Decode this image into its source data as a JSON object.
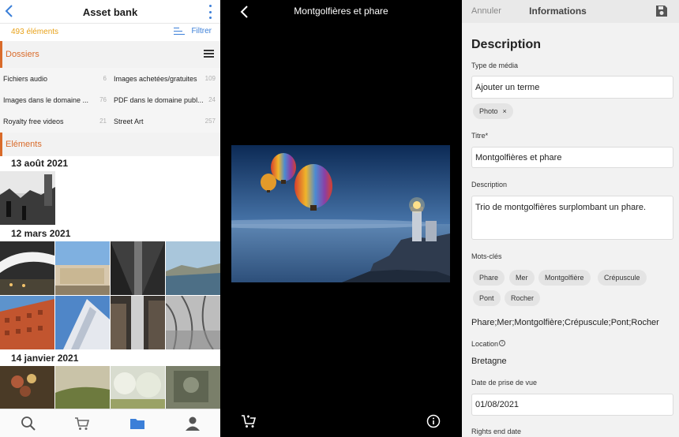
{
  "asset_bank": {
    "title": "Asset bank",
    "count": "493 éléments",
    "filter_label": "Filtrer",
    "folders_section": "Dossiers",
    "folders": [
      {
        "name": "Fichiers audio",
        "count": "6"
      },
      {
        "name": "Images achetées/gratuites",
        "count": "109"
      },
      {
        "name": "Images dans le domaine ...",
        "count": "76"
      },
      {
        "name": "PDF dans le domaine publ...",
        "count": "24"
      },
      {
        "name": "Royalty free videos",
        "count": "21"
      },
      {
        "name": "Street Art",
        "count": "257"
      }
    ],
    "elements_section": "Eléments",
    "groups": [
      {
        "date": "13 août 2021"
      },
      {
        "date": "12 mars 2021"
      },
      {
        "date": "14 janvier 2021"
      }
    ],
    "tabs": [
      "search-icon",
      "cart-icon",
      "folder-icon",
      "user-icon"
    ],
    "active_tab": "folder-icon"
  },
  "viewer": {
    "title": "Montgolfières et phare",
    "icons": [
      "back-icon",
      "add-to-cart-icon",
      "info-icon"
    ]
  },
  "info": {
    "cancel": "Annuler",
    "title": "Informations",
    "heading": "Description",
    "media_type_label": "Type de média",
    "media_type_placeholder": "Ajouter un terme",
    "media_type_chip": "Photo",
    "chip_remove": "×",
    "title_label": "Titre",
    "title_required": "*",
    "title_value": "Montgolfières et phare",
    "description_label": "Description",
    "description_value": "Trio de montgolfières surplombant un phare.",
    "keywords_label": "Mots-clés",
    "keywords": [
      "Phare",
      "Mer",
      "Montgolfière",
      "Crépuscule",
      "Pont",
      "Rocher"
    ],
    "keywords_text": "Phare;Mer;Montgolfière;Crépuscule;Pont;Rocher",
    "location_label": "Location",
    "location_info": "i",
    "location_value": "Bretagne",
    "date_label": "Date de prise de vue",
    "date_value": "01/08/2021",
    "rights_label": "Rights end date"
  },
  "colors": {
    "accent_blue": "#3b7fd8",
    "accent_orange": "#d96b2a",
    "count_yellow": "#e8a21a"
  }
}
